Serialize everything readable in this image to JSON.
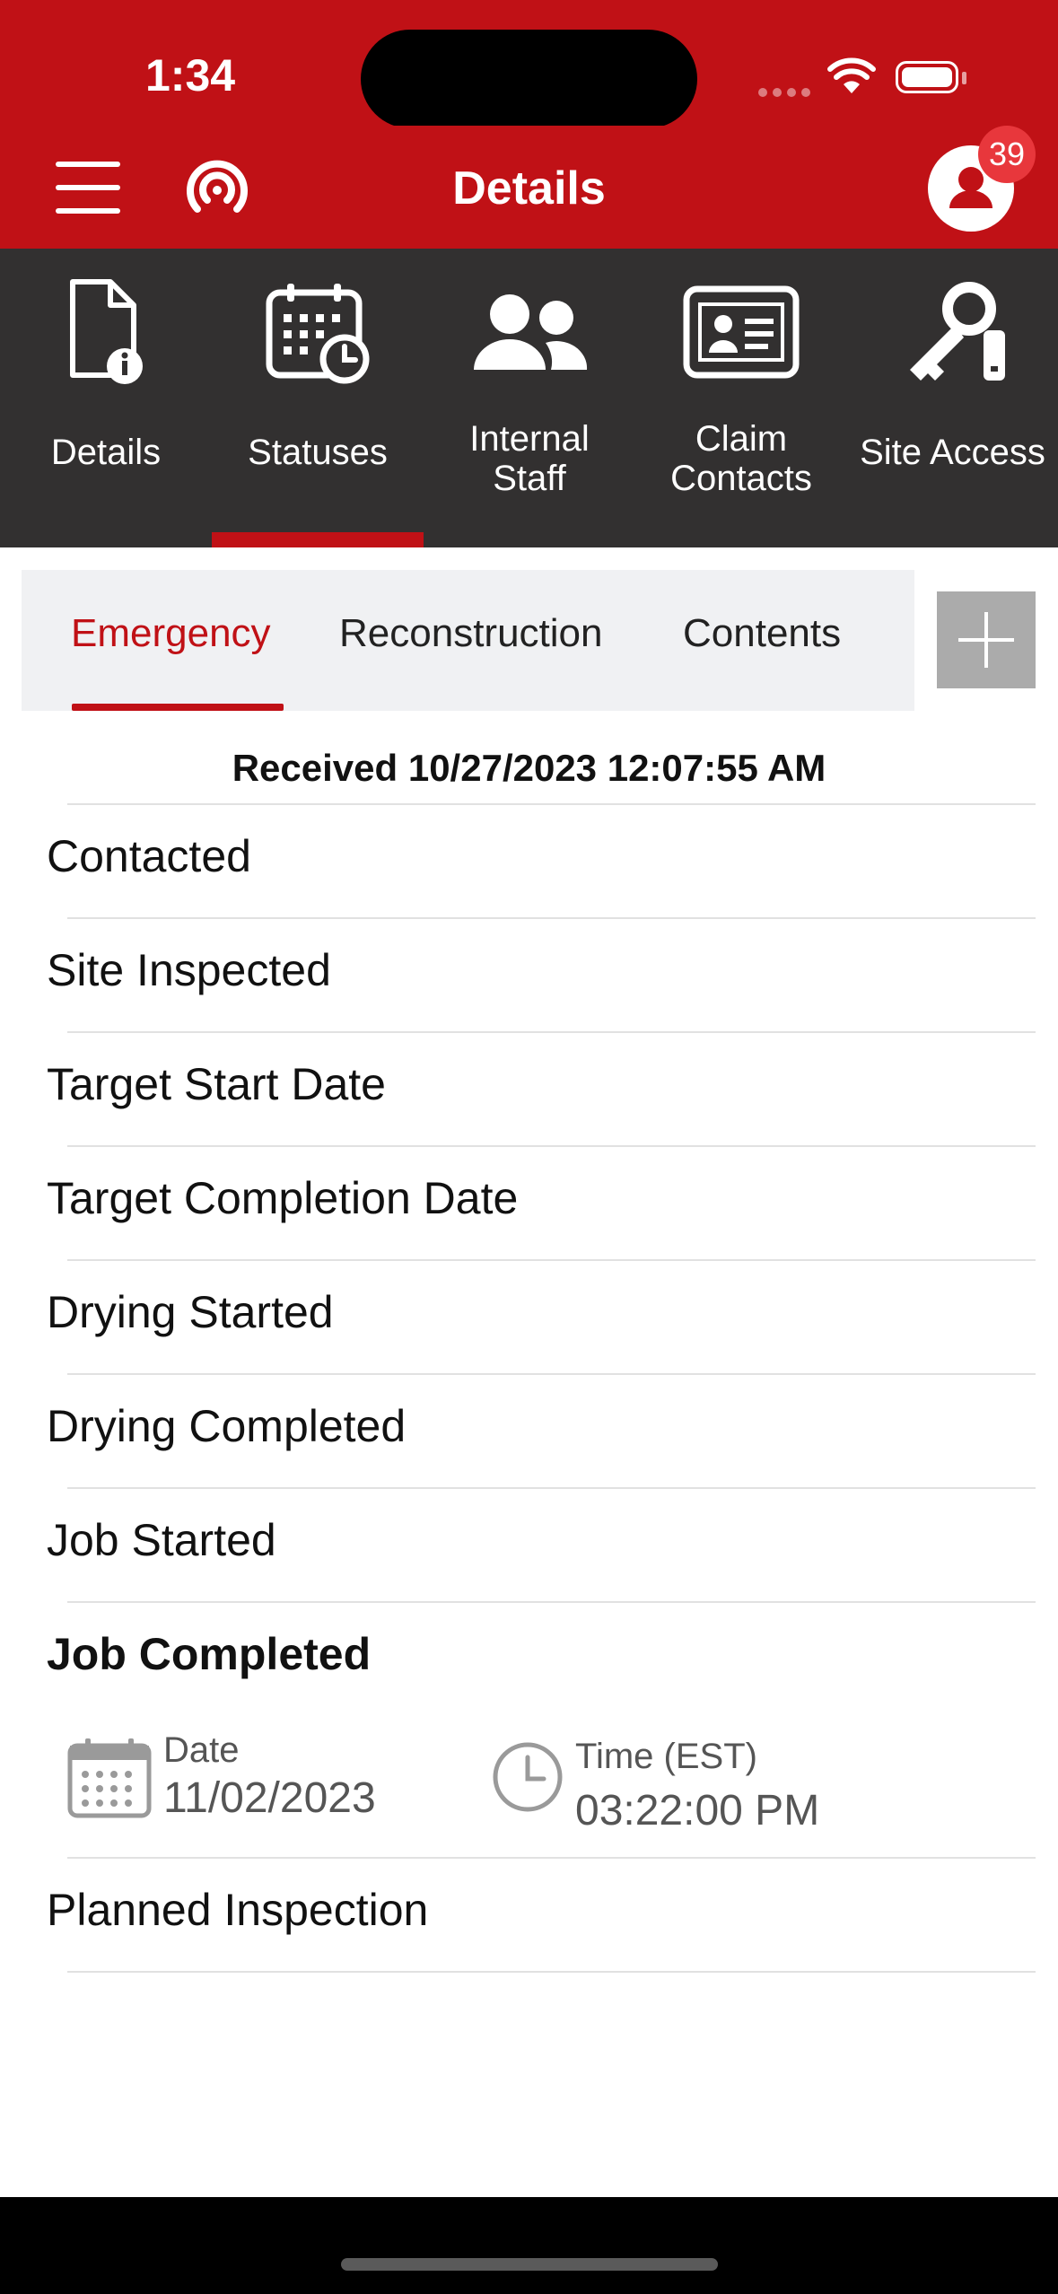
{
  "status_bar": {
    "time": "1:34"
  },
  "nav": {
    "title": "Details",
    "notification_count": "39"
  },
  "toolbar": {
    "items": [
      {
        "label": "Details"
      },
      {
        "label": "Statuses"
      },
      {
        "label_line1": "Internal",
        "label_line2": "Staff"
      },
      {
        "label_line1": "Claim",
        "label_line2": "Contacts"
      },
      {
        "label": "Site Access"
      }
    ],
    "active": "Statuses"
  },
  "tabs": {
    "items": [
      "Emergency",
      "Reconstruction",
      "Contents"
    ],
    "active": "Emergency"
  },
  "received": "Received 10/27/2023 12:07:55 AM",
  "statuses": [
    "Contacted",
    "Site Inspected",
    "Target Start Date",
    "Target Completion Date",
    "Drying Started",
    "Drying Completed",
    "Job Started",
    "Job Completed",
    "Planned Inspection"
  ],
  "job_completed": {
    "date_label": "Date",
    "date_value": "11/02/2023",
    "time_label": "Time (EST)",
    "time_value": "03:22:00 PM"
  },
  "colors": {
    "brand_red": "#c01116",
    "toolbar_dark": "#323030",
    "badge_red": "#e8373c"
  }
}
